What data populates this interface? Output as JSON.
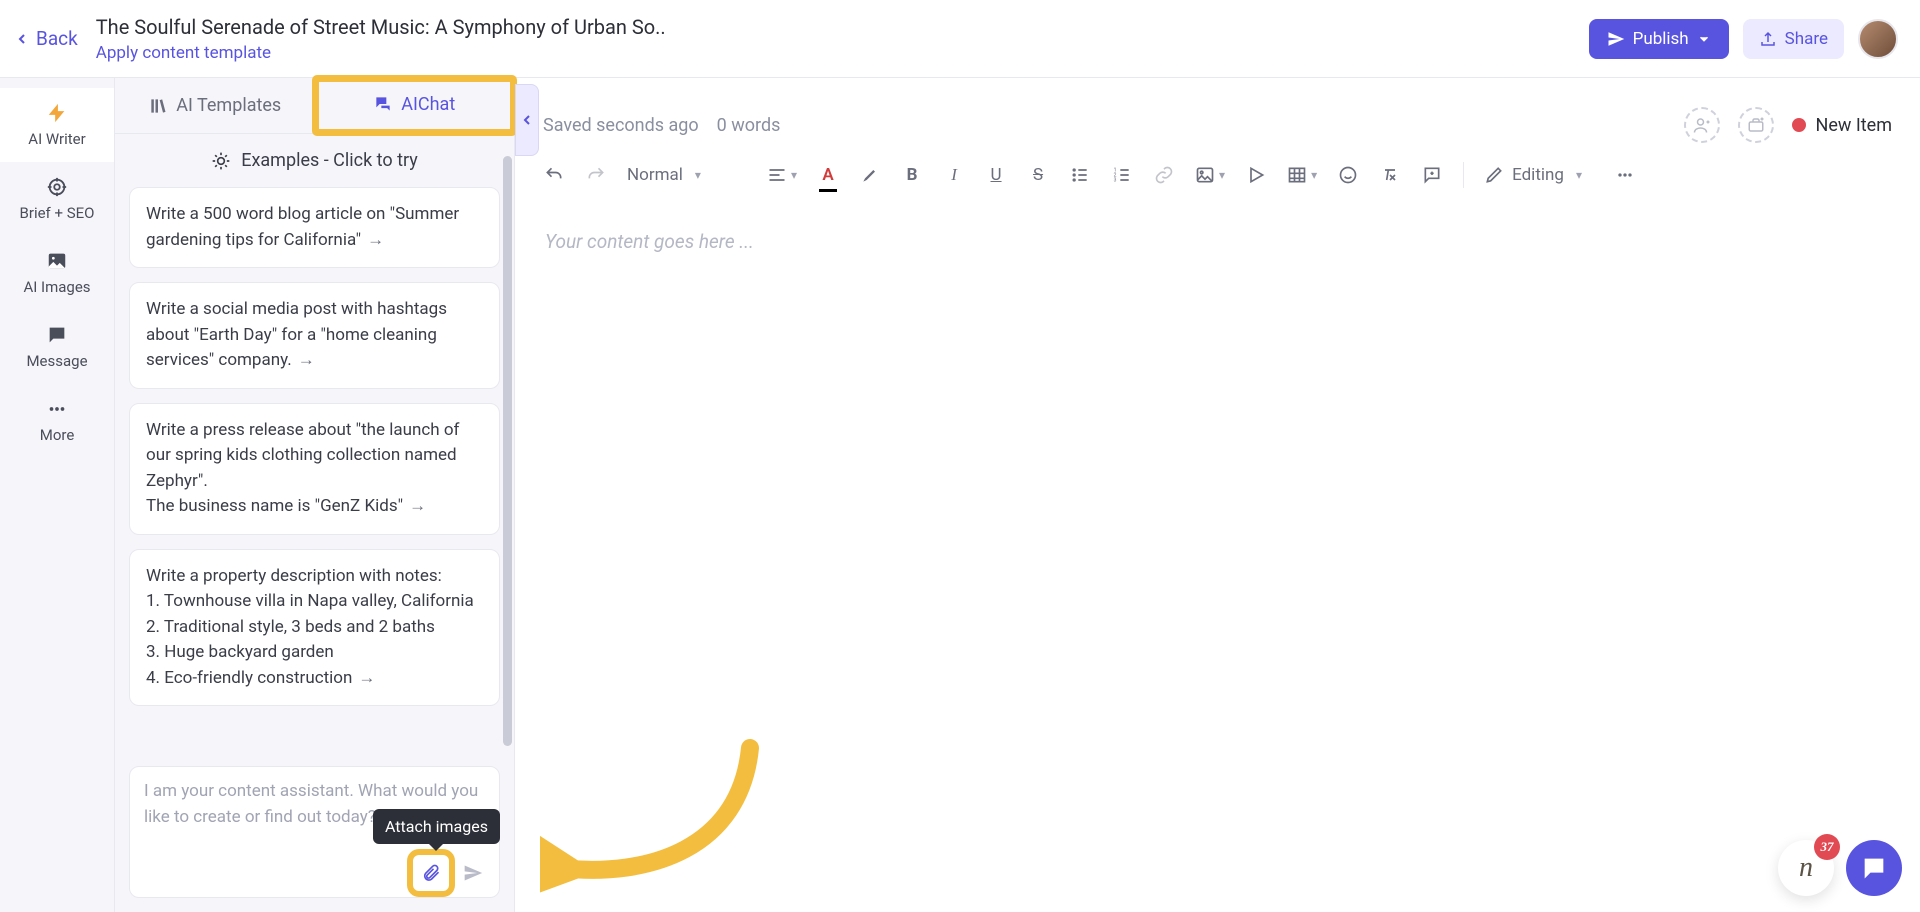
{
  "topbar": {
    "back_label": "Back",
    "title": "The Soulful Serenade of Street Music: A Symphony of Urban So..",
    "apply_template": "Apply content template",
    "publish_label": "Publish",
    "share_label": "Share"
  },
  "leftnav": {
    "items": [
      {
        "icon": "bolt",
        "label": "AI Writer"
      },
      {
        "icon": "target",
        "label": "Brief + SEO"
      },
      {
        "icon": "image",
        "label": "AI Images"
      },
      {
        "icon": "message",
        "label": "Message"
      },
      {
        "icon": "dots",
        "label": "More"
      }
    ]
  },
  "sidepanel": {
    "tabs": {
      "templates_label": "AI Templates",
      "aichat_label": "AIChat"
    },
    "examples_header": "Examples - Click to try",
    "examples": [
      "Write a 500 word blog article on \"Summer gardening tips for California\"",
      "Write a social media post with hashtags about \"Earth Day\" for a \"home cleaning services\" company.",
      "Write a press release about \"the launch of our spring kids clothing collection named Zephyr\".\nThe business name is \"GenZ Kids\"",
      "Write a property description with notes:\n1. Townhouse villa in Napa valley, California\n2. Traditional style, 3 beds and 2 baths\n3. Huge backyard garden\n4. Eco-friendly construction"
    ],
    "chat_placeholder": "I am your content assistant. What would you like to create or find out today?",
    "attach_tooltip": "Attach images"
  },
  "editor": {
    "saved_status": "Saved seconds ago",
    "word_count": "0 words",
    "new_item_label": "New Item",
    "text_style": "Normal",
    "mode_label": "Editing",
    "content_placeholder": "Your content goes here ..."
  },
  "float": {
    "letter": "n",
    "badge": "37"
  }
}
